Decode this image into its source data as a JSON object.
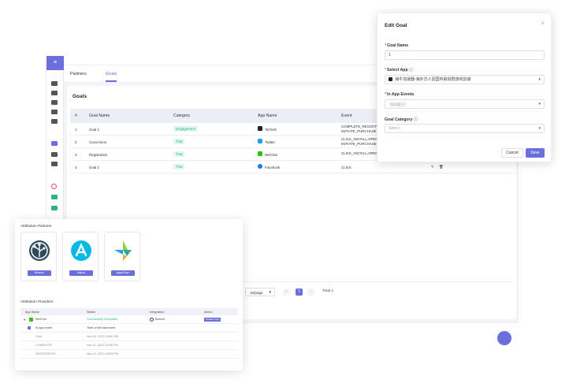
{
  "nav": {
    "tabs": [
      "Partners",
      "Goals"
    ],
    "rail_top": "≡"
  },
  "goals": {
    "title": "Goals",
    "headers": [
      "#",
      "Goal Name",
      "Category",
      "App Name",
      "Event"
    ],
    "rows": [
      {
        "num": "1",
        "name": "Goal 1",
        "category": "Engagement",
        "app": "TikTosh",
        "event1": "COMPLETE_REGISTR",
        "event2": "INITIATE_PURCHASE,",
        "app_color": "#222222"
      },
      {
        "num": "2",
        "name": "Conversion",
        "category": "Trial",
        "app": "Twitter",
        "event1": "CLICK_INSTALL,OPEN",
        "event2": "INITIATE_PURCHASE,",
        "app_color": "#1da1f2"
      },
      {
        "num": "3",
        "name": "Registration",
        "category": "Trial",
        "app": "WeChat",
        "event1": "CLICK_INSTALL,OPEN",
        "event2": "",
        "app_color": "#2dc100"
      },
      {
        "num": "4",
        "name": "Goal 1",
        "category": "Trial",
        "app": "Facebook",
        "event1": "CLICK",
        "event2": "",
        "app_color": "#1877f2"
      }
    ],
    "pagination": {
      "per_page": "10/page",
      "current": "1",
      "total": "Total 1"
    }
  },
  "modal": {
    "title": "Edit Goal",
    "goal_name_label": "Goal Name",
    "goal_name_value": "1",
    "select_app_label": "Select App",
    "select_app_value": "海牛加速器-海外华人回国听歌追剧游戏加速",
    "events_label": "In App Events",
    "events_chip": "CLICK ×",
    "category_label": "Goal Category",
    "category_placeholder": "Select",
    "cancel": "Cancel",
    "save": "Save",
    "close": "×"
  },
  "partners": {
    "title": "Attribution Partners",
    "cards": [
      {
        "label": "Branch"
      },
      {
        "label": "Adjust"
      },
      {
        "label": "AppsFlyer"
      }
    ],
    "providers_title": "Attribution Providers",
    "headers": [
      "App Name",
      "Status",
      "Integration",
      "Action"
    ],
    "app_row": {
      "app": "WeChat",
      "status": "Successfully Integrated",
      "integration": "Branch",
      "action": "Update Goal"
    },
    "event_header": {
      "col1": "In-app event",
      "col2": "Time of the last event"
    },
    "events": [
      {
        "name": "Click",
        "time": "Nov 19, 2022 18:52 PM"
      },
      {
        "name": "COMPLETE",
        "time": "Nov 11, 2022 18:55 PM"
      },
      {
        "name": "REGISTRATIO",
        "time": "Nov 10, 2022 18:53 PM"
      }
    ]
  }
}
